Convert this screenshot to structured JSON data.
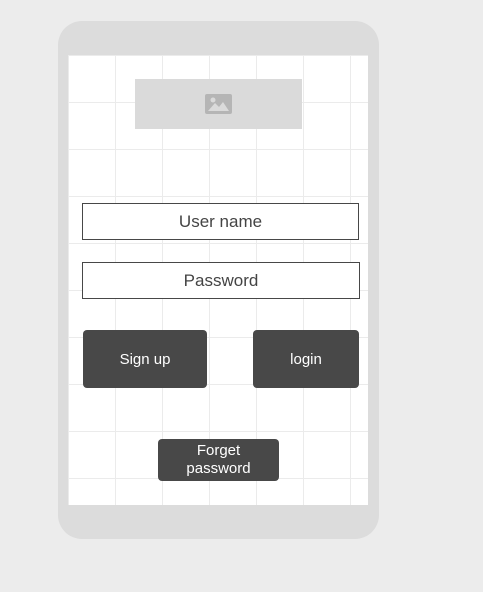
{
  "login_form": {
    "image_icon": "image-icon",
    "username_placeholder": "User name",
    "password_placeholder": "Password",
    "signup_label": "Sign up",
    "login_label": "login",
    "forget_password_label": "Forget password"
  },
  "colors": {
    "background": "#ececec",
    "device_frame": "#dcdcdc",
    "button": "#484848",
    "placeholder_image": "#dadada"
  }
}
